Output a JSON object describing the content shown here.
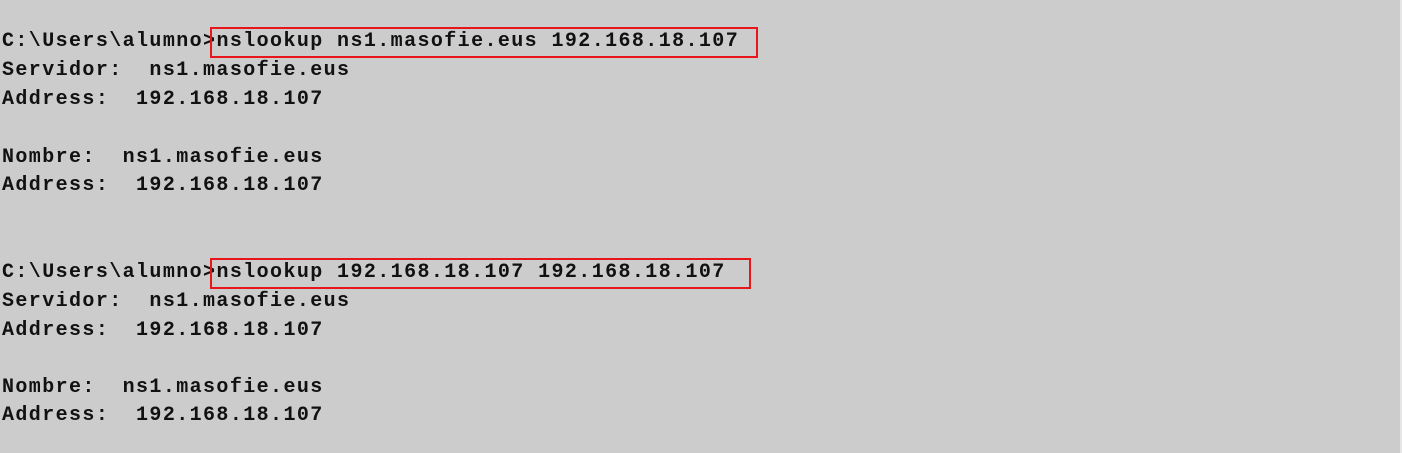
{
  "console": {
    "highlight_color": "#e8161b",
    "blocks": [
      {
        "prompt": "C:\\Users\\alumno>",
        "command": "nslookup ns1.masofie.eus 192.168.18.107",
        "server_line": "Servidor:  ns1.masofie.eus",
        "server_address_line": "Address:  192.168.18.107",
        "name_line": "Nombre:  ns1.masofie.eus",
        "address_line": "Address:  192.168.18.107"
      },
      {
        "prompt": "C:\\Users\\alumno>",
        "command": "nslookup 192.168.18.107 192.168.18.107",
        "server_line": "Servidor:  ns1.masofie.eus",
        "server_address_line": "Address:  192.168.18.107",
        "name_line": "Nombre:  ns1.masofie.eus",
        "address_line": "Address:  192.168.18.107"
      }
    ]
  }
}
